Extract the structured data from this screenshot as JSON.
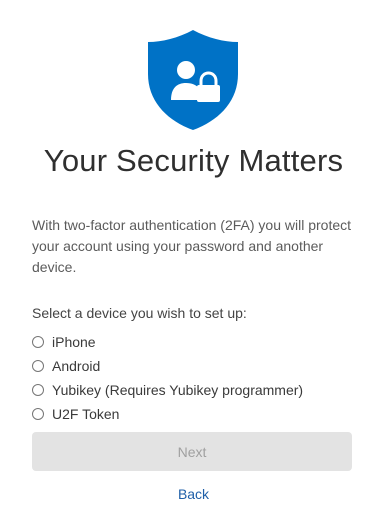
{
  "header": {
    "icon": "shield-user-lock-icon",
    "title": "Your Security Matters"
  },
  "intro": {
    "text": "With two-factor authentication (2FA) you will protect your account using your password and another device."
  },
  "device_selection": {
    "prompt": "Select a device you wish to set up:",
    "options": [
      {
        "label": "iPhone"
      },
      {
        "label": "Android"
      },
      {
        "label": "Yubikey (Requires Yubikey programmer)"
      },
      {
        "label": "U2F Token"
      }
    ]
  },
  "actions": {
    "next_label": "Next",
    "back_label": "Back"
  },
  "colors": {
    "accent": "#0072c6",
    "link": "#1f5fa8",
    "disabled_bg": "#e3e3e3",
    "disabled_text": "#a0a0a0"
  }
}
